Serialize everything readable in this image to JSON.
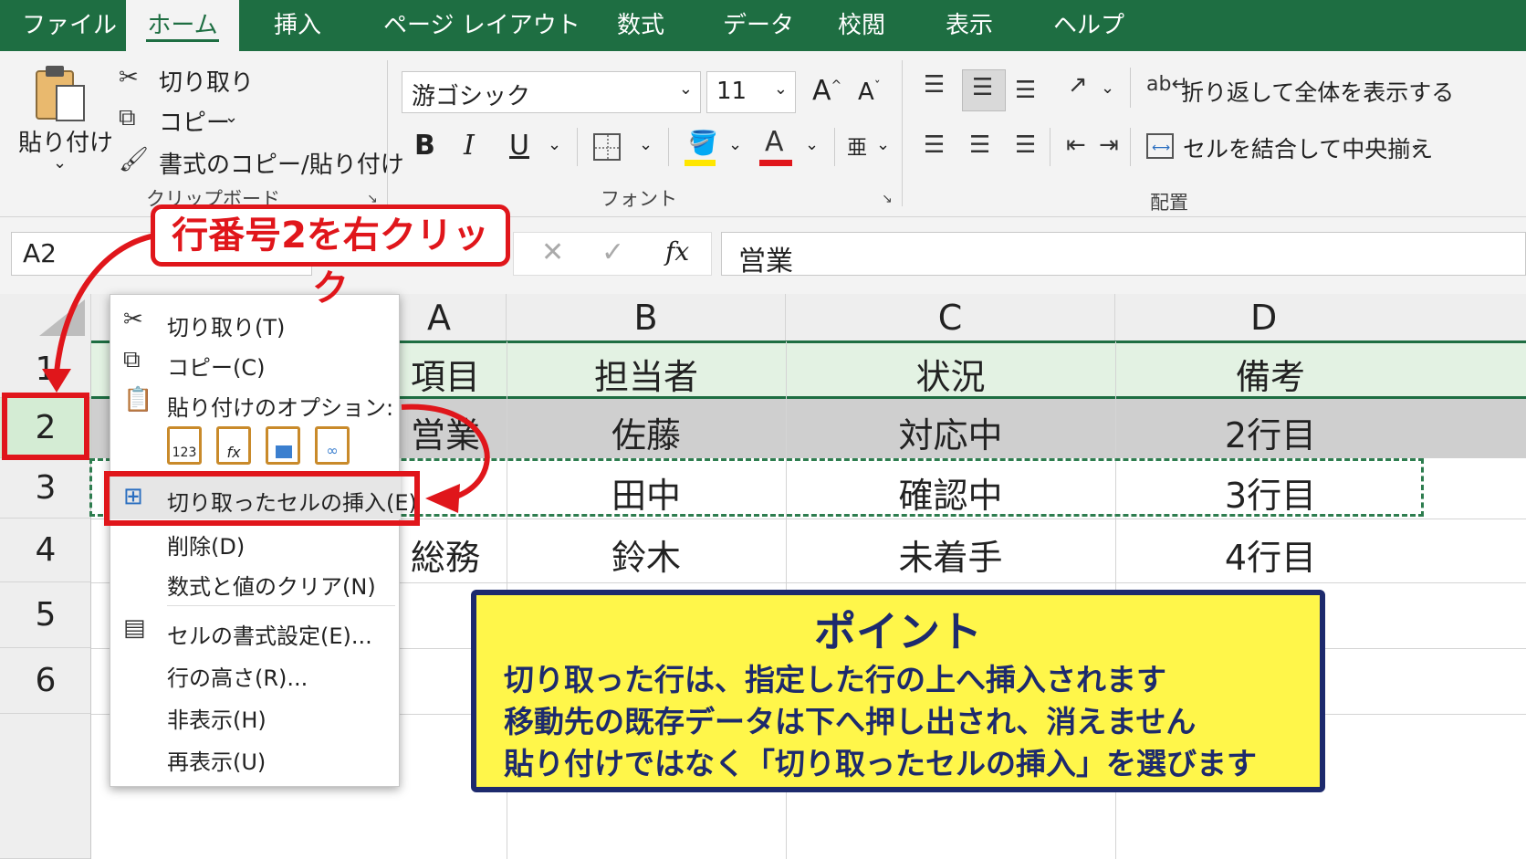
{
  "tabs": [
    "ファイル",
    "ホーム",
    "挿入",
    "ページ レイアウト",
    "数式",
    "データ",
    "校閲",
    "表示",
    "ヘルプ"
  ],
  "ribbon": {
    "clipboard": {
      "paste": "貼り付け",
      "cut": "切り取り",
      "copy": "コピー",
      "format_painter": "書式のコピー/貼り付け",
      "group": "クリップボード"
    },
    "font": {
      "name": "游ゴシック",
      "size": "11",
      "group": "フォント",
      "grow": "A",
      "shrink": "A",
      "bold": "B",
      "italic": "I",
      "underline": "U"
    },
    "alignment": {
      "wrap": "折り返して全体を表示する",
      "merge": "セルを結合して中央揃え",
      "group": "配置"
    }
  },
  "formula_bar": {
    "name_box": "A2",
    "fx": "fx",
    "value": "営業"
  },
  "columns": [
    "A",
    "B",
    "C",
    "D"
  ],
  "rows": [
    "1",
    "2",
    "3",
    "4",
    "5",
    "6"
  ],
  "cells": {
    "r1": [
      "項目",
      "担当者",
      "状況",
      "備考"
    ],
    "r2": [
      "営業",
      "佐藤",
      "対応中",
      "2行目"
    ],
    "r3": [
      "",
      "田中",
      "確認中",
      "3行目"
    ],
    "r4": [
      "総務",
      "鈴木",
      "未着手",
      "4行目"
    ]
  },
  "context_menu": {
    "cut": "切り取り(T)",
    "copy": "コピー(C)",
    "paste_options": "貼り付けのオプション:",
    "insert_cut": "切り取ったセルの挿入(E)",
    "delete": "削除(D)",
    "clear": "数式と値のクリア(N)",
    "format_cells": "セルの書式設定(E)...",
    "row_height": "行の高さ(R)...",
    "hide": "非表示(H)",
    "unhide": "再表示(U)"
  },
  "callout_top": "行番号2を右クリック",
  "point_box": {
    "title": "ポイント",
    "lines": [
      "切り取った行は、指定した行の上へ挿入されます",
      "移動先の既存データは下へ押し出され、消えません",
      "貼り付けではなく「切り取ったセルの挿入」を選びます"
    ]
  },
  "colors": {
    "excel_green": "#1e6e42",
    "red": "#e0161b",
    "yellow": "#fff64a",
    "navy": "#1d2a6d",
    "header_row": "#e3f2e3",
    "selected_row": "#cfcfcf"
  }
}
